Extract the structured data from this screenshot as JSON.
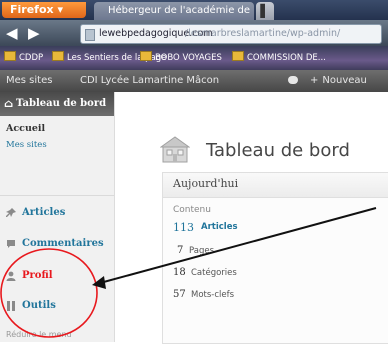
{
  "browser": {
    "app_button": "Firefox ▾",
    "tabs": [
      {
        "label": "Hébergeur de l'académie de Dijon"
      },
      {
        "label": "▌"
      }
    ],
    "url": {
      "host": "lewebpedagogique.com",
      "path": "/lesmarbreslamartine/wp-admin/"
    },
    "bookmarks": [
      {
        "label": "CDDP"
      },
      {
        "label": "Les Sentiers de la page"
      },
      {
        "label": "BOBO VOYAGES"
      },
      {
        "label": "COMMISSION DE..."
      }
    ]
  },
  "wp_toolbar": {
    "my_sites": "Mes sites",
    "site_name": "CDI Lycée Lamartine Mâcon",
    "new_label": "Nouveau",
    "new_icon": "+"
  },
  "admin_menu": {
    "dashboard": "Tableau de bord",
    "submenu": {
      "home": "Accueil",
      "my_sites": "Mes sites"
    },
    "items": [
      {
        "label": "Articles",
        "icon": "pin-icon"
      },
      {
        "label": "Commentaires",
        "icon": "comment-bubble-icon"
      },
      {
        "label": "Profil",
        "icon": "user-profile-icon"
      },
      {
        "label": "Outils",
        "icon": "tools-icon"
      }
    ],
    "collapse": "Réduire le menu"
  },
  "main": {
    "title": "Tableau de bord",
    "widget": {
      "title": "Aujourd'hui",
      "section_label": "Contenu",
      "stats": [
        {
          "count": "113",
          "label": "Articles"
        },
        {
          "count": "7",
          "label": "Pages"
        },
        {
          "count": "18",
          "label": "Catégories"
        },
        {
          "count": "57",
          "label": "Mots-clefs"
        }
      ]
    }
  },
  "annotation": {
    "circle_color": "#e8191e",
    "arrow_color": "#111111"
  },
  "colors": {
    "link_blue": "#21759b",
    "toolbar_gray": "#474747",
    "firefox_orange": "#e0661a"
  }
}
